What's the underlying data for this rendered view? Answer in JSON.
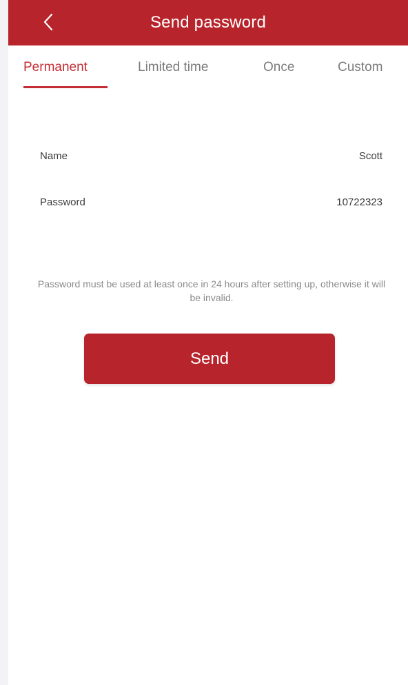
{
  "header": {
    "back_icon": "chevron-left-icon",
    "title": "Send password"
  },
  "tabs": [
    {
      "label": "Permanent",
      "active": true
    },
    {
      "label": "Limited time",
      "active": false
    },
    {
      "label": "Once",
      "active": false
    },
    {
      "label": "Custom",
      "active": false
    }
  ],
  "form": {
    "name_label": "Name",
    "name_value": "Scott",
    "password_label": "Password",
    "password_value": "10722323"
  },
  "hint": "Password must be used at least once in 24 hours after setting up, otherwise it will be invalid.",
  "send_label": "Send",
  "colors": {
    "accent": "#b8242b",
    "tab_active": "#c42d33",
    "tab_inactive": "#7c7c7c"
  }
}
